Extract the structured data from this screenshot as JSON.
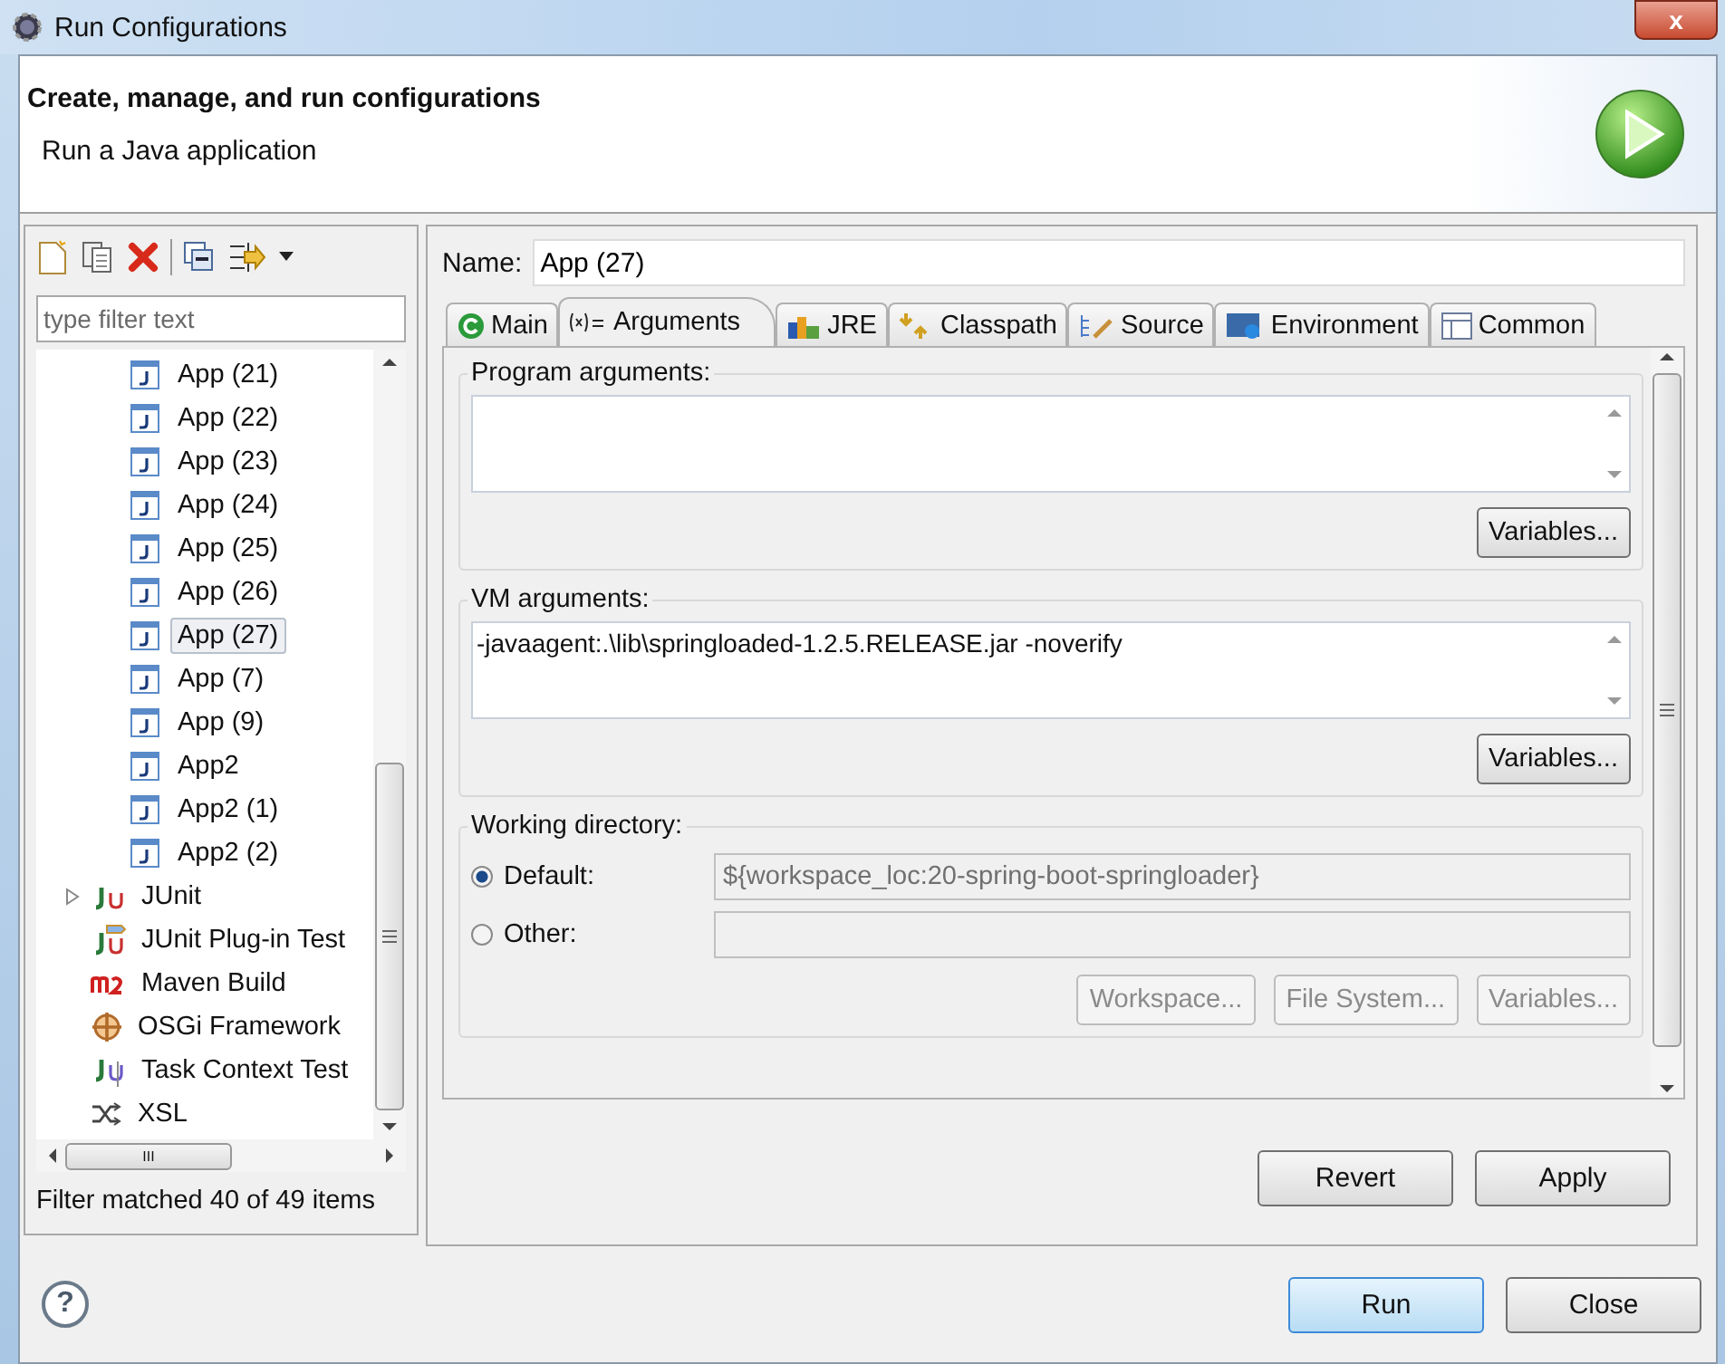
{
  "window": {
    "title": "Run Configurations",
    "close_label": "x"
  },
  "header": {
    "title": "Create, manage, and run configurations",
    "subtitle": "Run a Java application"
  },
  "sidebar": {
    "filter": {
      "placeholder": "type filter text"
    },
    "configs": [
      {
        "label": "App (21)",
        "selected": false
      },
      {
        "label": "App (22)",
        "selected": false
      },
      {
        "label": "App (23)",
        "selected": false
      },
      {
        "label": "App (24)",
        "selected": false
      },
      {
        "label": "App (25)",
        "selected": false
      },
      {
        "label": "App (26)",
        "selected": false
      },
      {
        "label": "App (27)",
        "selected": true
      },
      {
        "label": "App (7)",
        "selected": false
      },
      {
        "label": "App (9)",
        "selected": false
      },
      {
        "label": "App2",
        "selected": false
      },
      {
        "label": "App2 (1)",
        "selected": false
      },
      {
        "label": "App2 (2)",
        "selected": false
      }
    ],
    "types": [
      {
        "label": "JUnit",
        "kind": "junit",
        "expandable": true,
        "selected": false
      },
      {
        "label": "JUnit Plug-in Test",
        "kind": "plugin",
        "expandable": false,
        "selected": false
      },
      {
        "label": "Maven Build",
        "kind": "maven",
        "expandable": false,
        "selected": false
      },
      {
        "label": "OSGi Framework",
        "kind": "osgi",
        "expandable": false,
        "selected": false
      },
      {
        "label": "Task Context Test",
        "kind": "task",
        "expandable": false,
        "selected": false
      },
      {
        "label": "XSL",
        "kind": "xsl",
        "expandable": false,
        "selected": false
      }
    ],
    "hscroll_grip": "III",
    "status": "Filter matched 40 of 49 items"
  },
  "editor": {
    "name_label": "Name:",
    "name": "App (27)",
    "tabs": [
      {
        "label": "Main",
        "kind": "main",
        "selected": false
      },
      {
        "label": "Arguments",
        "kind": "args",
        "selected": true
      },
      {
        "label": "JRE",
        "kind": "jre",
        "selected": false
      },
      {
        "label": "Classpath",
        "kind": "classpath",
        "selected": false
      },
      {
        "label": "Source",
        "kind": "source",
        "selected": false
      },
      {
        "label": "Environment",
        "kind": "env",
        "selected": false
      },
      {
        "label": "Common",
        "kind": "common",
        "selected": false
      }
    ],
    "program_arguments": {
      "label": "Program arguments:",
      "button": "Variables..."
    },
    "vm_arguments": {
      "label": "VM arguments:",
      "value": "-javaagent:.\\lib\\springloaded-1.2.5.RELEASE.jar -noverify",
      "button": "Variables..."
    },
    "working_directory": {
      "label": "Working directory:",
      "options": [
        {
          "label": "Default:",
          "selected": true,
          "value": "${workspace_loc:20-spring-boot-springloader}"
        },
        {
          "label": "Other:",
          "selected": false
        }
      ],
      "buttons": [
        {
          "label": "Workspace...",
          "disabled": true
        },
        {
          "label": "File System...",
          "disabled": true
        },
        {
          "label": "Variables...",
          "disabled": true
        }
      ]
    },
    "actions": [
      {
        "label": "Revert"
      },
      {
        "label": "Apply"
      }
    ]
  },
  "footer": {
    "help": "?",
    "buttons": [
      {
        "label": "Run",
        "default": true
      },
      {
        "label": "Close",
        "default": false
      }
    ]
  }
}
